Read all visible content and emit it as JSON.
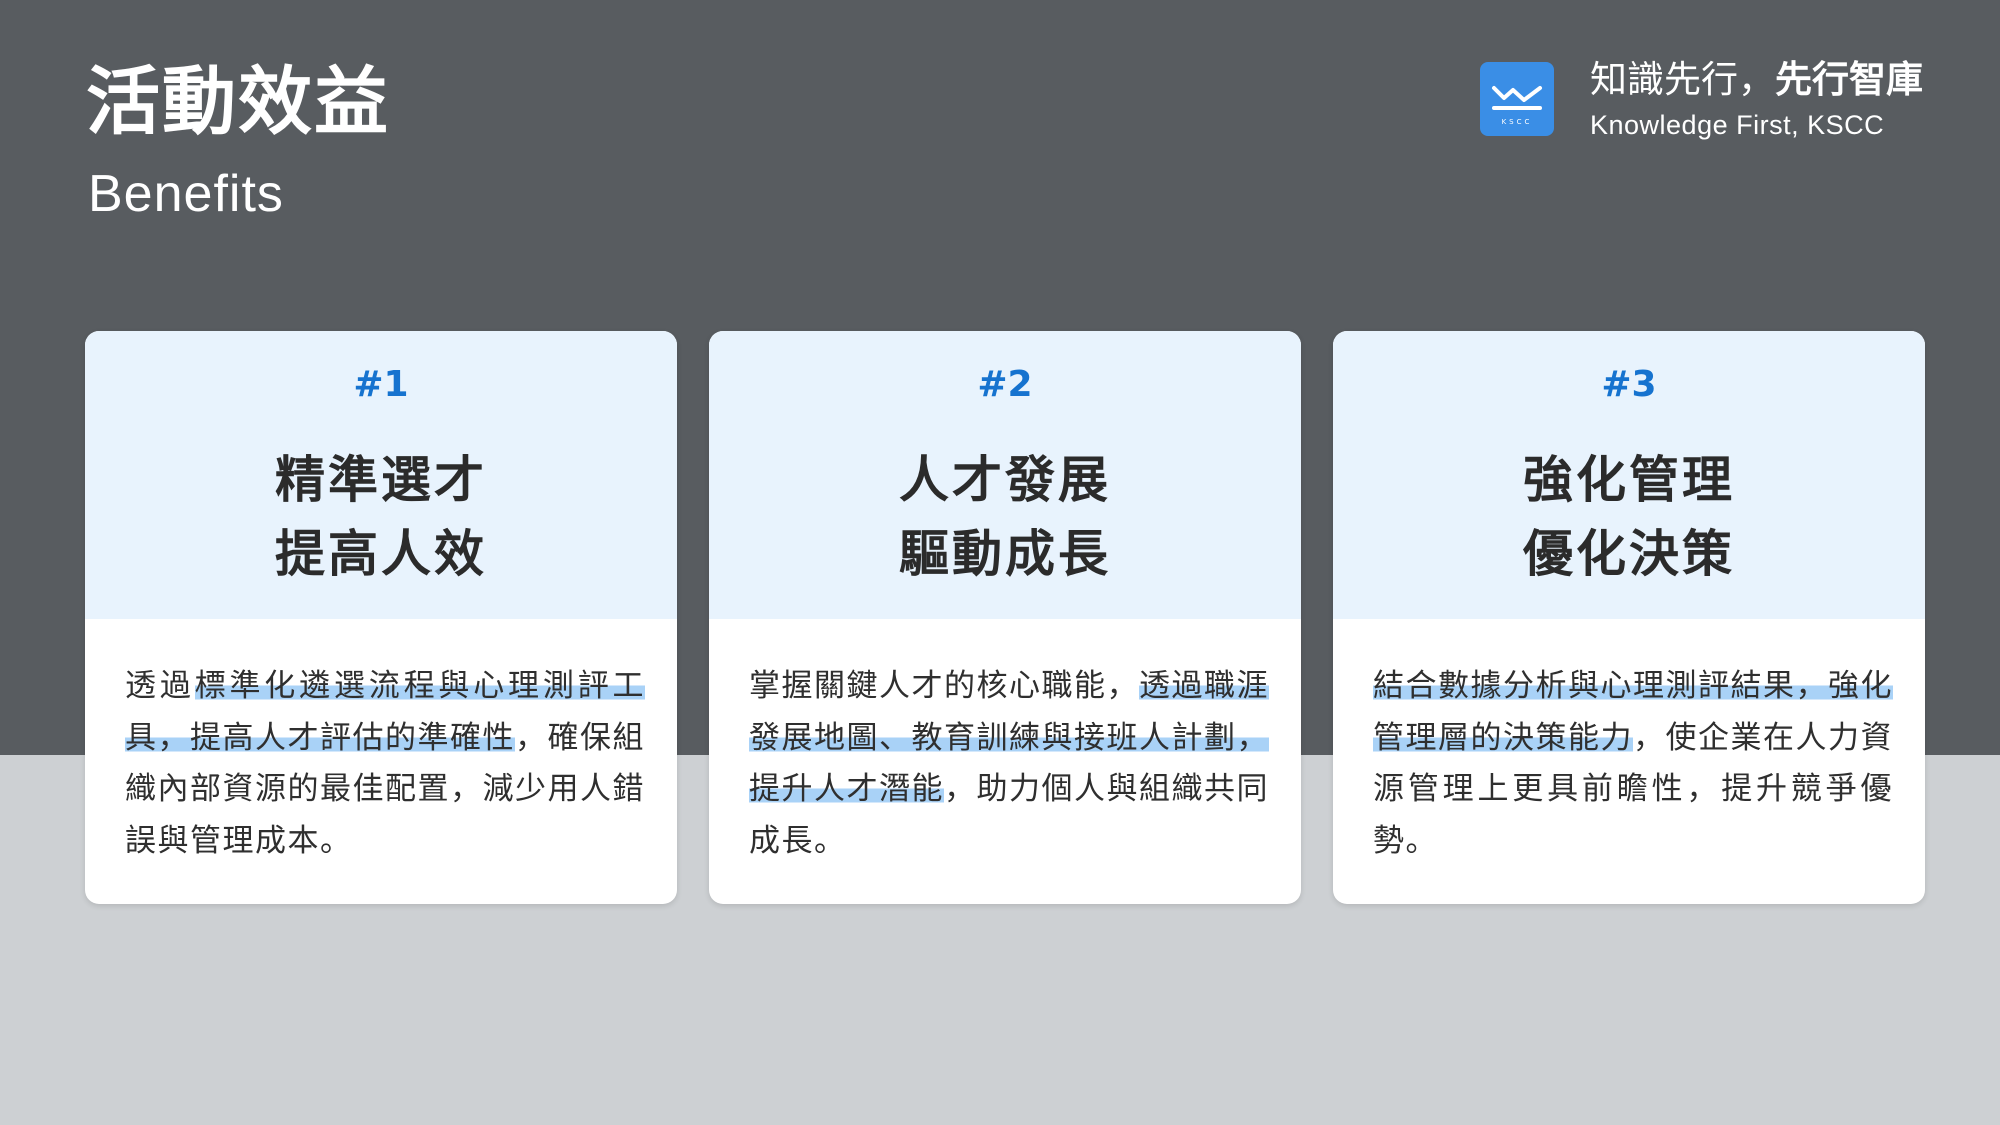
{
  "header": {
    "title_zh": "活動效益",
    "title_en": "Benefits"
  },
  "brand": {
    "logo_icon": "kscc-logo-icon",
    "slogan_regular": "知識先行，",
    "slogan_bold": "先行智庫",
    "tagline": "Knowledge First, KSCC"
  },
  "colors": {
    "top_band": "#585c60",
    "bottom_band": "#cdd0d3",
    "card_head": "#e8f3fd",
    "accent_number": "#1673cf",
    "highlight": "#a9d2f7",
    "logo": "#3a8ee6"
  },
  "cards": [
    {
      "number": "#1",
      "title_line1": "精準選才",
      "title_line2": "提高人效",
      "body_pre": "透過",
      "body_highlight": "標準化遴選流程與心理測評工具，提高人才評估的準確性",
      "body_post": "，確保組織內部資源的最佳配置，減少用人錯誤與管理成本。"
    },
    {
      "number": "#2",
      "title_line1": "人才發展",
      "title_line2": "驅動成長",
      "body_pre": "掌握關鍵人才的核心職能，",
      "body_highlight": "透過職涯發展地圖、教育訓練與接班人計劃，提升人才潛能",
      "body_post": "，助力個人與組織共同成長。"
    },
    {
      "number": "#3",
      "title_line1": "強化管理",
      "title_line2": "優化決策",
      "body_pre": "",
      "body_highlight": "結合數據分析與心理測評結果，強化管理層的決策能力",
      "body_post": "，使企業在人力資源管理上更具前瞻性，提升競爭優勢。"
    }
  ]
}
